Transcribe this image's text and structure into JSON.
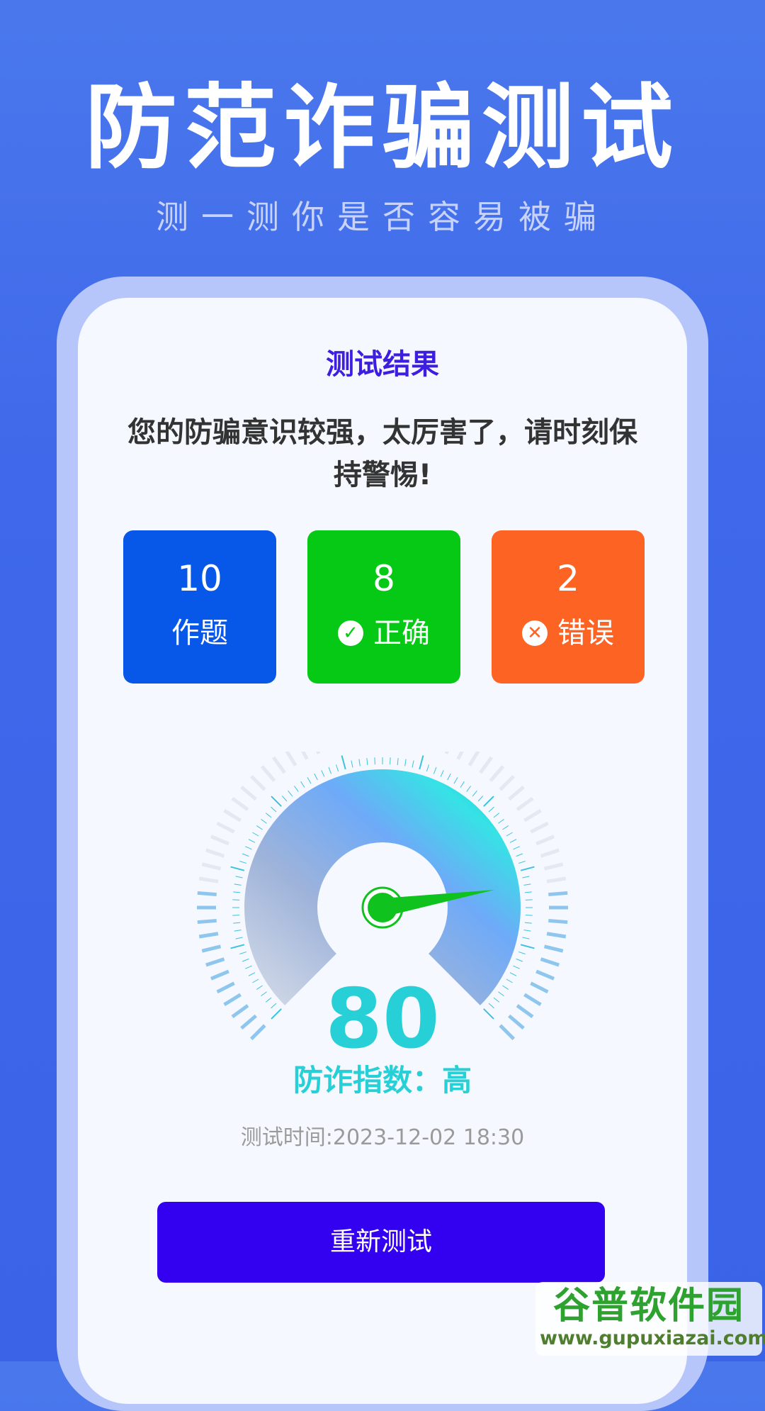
{
  "hero": {
    "title": "防范诈骗测试",
    "subtitle": "测一测你是否容易被骗"
  },
  "result": {
    "title": "测试结果",
    "message": "您的防骗意识较强，太厉害了，请时刻保持警惕!"
  },
  "stats": {
    "total": {
      "value": "10",
      "label": "作题"
    },
    "correct": {
      "value": "8",
      "label": "正确",
      "icon": "check-circle-icon"
    },
    "wrong": {
      "value": "2",
      "label": "错误",
      "icon": "x-circle-icon"
    }
  },
  "gauge": {
    "score": "80",
    "level_text": "防诈指数：高",
    "fraction": 0.8
  },
  "test_time": "测试时间:2023-12-02 18:30",
  "retest_button": "重新测试",
  "watermark": {
    "brand": "谷普软件园",
    "url": "www.gupuxiazai.com"
  },
  "colors": {
    "background": "#4a78ec",
    "result_title": "#3b1ee0",
    "card_total": "#0757e8",
    "card_correct": "#06c915",
    "card_wrong": "#fd6424",
    "score": "#27d0d6",
    "button": "#3400f0"
  }
}
